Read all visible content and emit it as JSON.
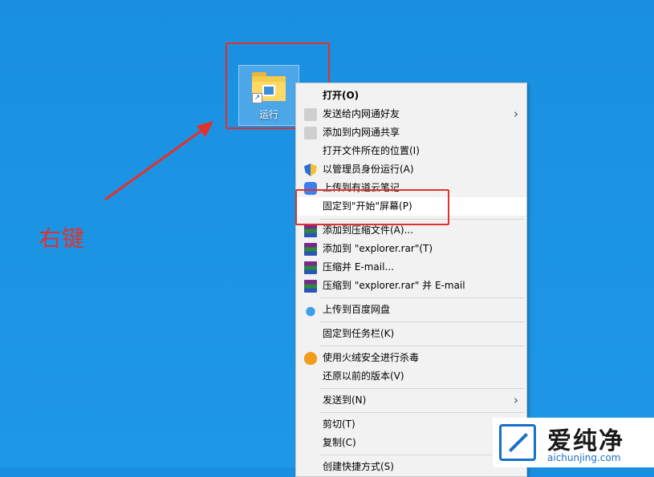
{
  "desktop": {
    "icon_label": "运行"
  },
  "annotation": {
    "text": "右键"
  },
  "context_menu": {
    "items": [
      {
        "label": "打开(O)",
        "icon": "none",
        "bold": true
      },
      {
        "label": "发送给内网通好友",
        "icon": "intranet-share-icon",
        "submenu": true
      },
      {
        "label": "添加到内网通共享",
        "icon": "intranet-share-icon"
      },
      {
        "label": "打开文件所在的位置(I)",
        "icon": "none"
      },
      {
        "label": "以管理员身份运行(A)",
        "icon": "uac-shield-icon"
      },
      {
        "label": "上传到有道云笔记",
        "icon": "youdao-note-icon"
      },
      {
        "label": "固定到\"开始\"屏幕(P)",
        "icon": "none",
        "highlighted": true
      },
      {
        "label": "添加到压缩文件(A)...",
        "icon": "winrar-icon"
      },
      {
        "label": "添加到 \"explorer.rar\"(T)",
        "icon": "winrar-icon"
      },
      {
        "label": "压缩并 E-mail...",
        "icon": "winrar-icon"
      },
      {
        "label": "压缩到 \"explorer.rar\" 并 E-mail",
        "icon": "winrar-icon"
      },
      {
        "label": "上传到百度网盘",
        "icon": "baidu-netdisk-icon"
      },
      {
        "label": "固定到任务栏(K)",
        "icon": "none"
      },
      {
        "label": "使用火绒安全进行杀毒",
        "icon": "huorong-icon"
      },
      {
        "label": "还原以前的版本(V)",
        "icon": "none"
      },
      {
        "label": "发送到(N)",
        "icon": "none",
        "submenu": true
      },
      {
        "label": "剪切(T)",
        "icon": "none"
      },
      {
        "label": "复制(C)",
        "icon": "none"
      },
      {
        "label": "创建快捷方式(S)",
        "icon": "none"
      }
    ]
  },
  "watermark": {
    "title": "爱纯净",
    "url": "aichunjing.com"
  },
  "colors": {
    "desktop_bg": "#1c93e3",
    "annotation_red": "#e0322d",
    "menu_bg": "#f2f2f2"
  }
}
